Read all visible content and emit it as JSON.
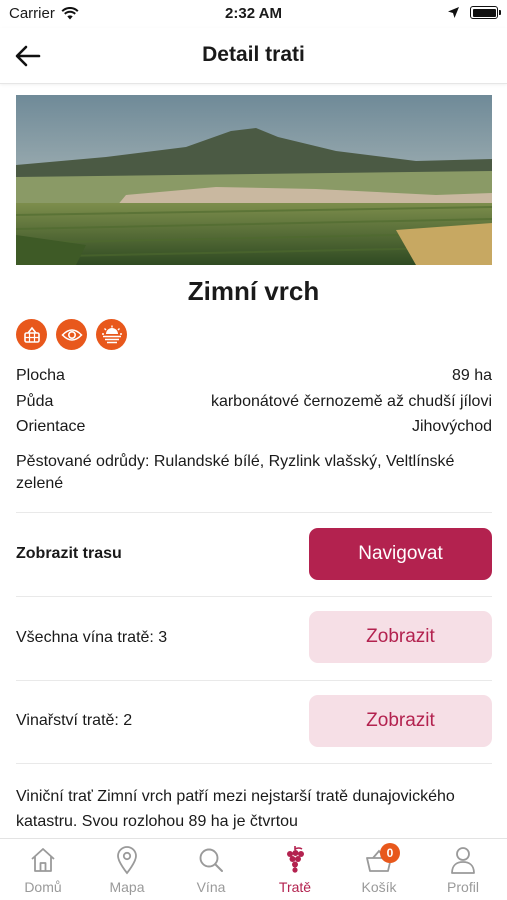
{
  "status_bar": {
    "carrier": "Carrier",
    "time": "2:32 AM"
  },
  "header": {
    "title": "Detail trati",
    "back_icon": "arrow-left-icon"
  },
  "vineyard": {
    "name": "Zimní vrch",
    "feature_icons": [
      "basket-icon",
      "eye-icon",
      "sun-field-icon"
    ],
    "properties": [
      {
        "label": "Plocha",
        "value": "89 ha"
      },
      {
        "label": "Půda",
        "value": "karbonátové černozemě až chudší jílovi"
      },
      {
        "label": "Orientace",
        "value": "Jihovýchod"
      }
    ],
    "varieties_label": "Pěstované odrůdy:",
    "varieties_value": "Rulandské bílé, Ryzlink vlašský, Veltlínské zelené",
    "description": "Viniční trať Zimní vrch patří mezi nejstarší tratě dunajovického katastru. Svou rozlohou 89 ha je čtvrtou"
  },
  "actions": {
    "route_label": "Zobrazit trasu",
    "navigate_button": "Navigovat",
    "wines_label": "Všechna vína tratě: 3",
    "wines_button": "Zobrazit",
    "wineries_label": "Vinařství tratě: 2",
    "wineries_button": "Zobrazit"
  },
  "tab_bar": {
    "items": [
      {
        "label": "Domů",
        "icon": "home-icon"
      },
      {
        "label": "Mapa",
        "icon": "map-pin-icon"
      },
      {
        "label": "Vína",
        "icon": "search-icon"
      },
      {
        "label": "Tratě",
        "icon": "grapes-icon",
        "active": true
      },
      {
        "label": "Košík",
        "icon": "basket-icon",
        "badge": "0"
      },
      {
        "label": "Profil",
        "icon": "profile-icon"
      }
    ]
  },
  "colors": {
    "brand": "#b3224f",
    "brand_light": "#f6dfe6",
    "accent": "#e8581c",
    "inactive": "#9a9a9a"
  }
}
